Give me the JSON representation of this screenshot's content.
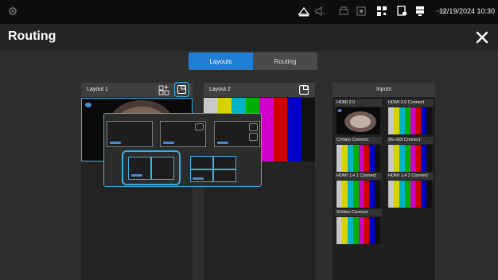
{
  "status": {
    "clock": "12/19/2024 10:30"
  },
  "header": {
    "title": "Routing"
  },
  "tabs": [
    {
      "label": "Layouts",
      "active": true
    },
    {
      "label": "Routing",
      "active": false
    }
  ],
  "layouts": [
    {
      "label": "Layout 1"
    },
    {
      "label": "Layout 2"
    }
  ],
  "inputs": {
    "title": "Inputs",
    "items": [
      {
        "label": "HDMI 2.0",
        "kind": "camera"
      },
      {
        "label": "HDMI 2.0 Connect",
        "kind": "bars"
      },
      {
        "label": "CVideo Connect",
        "kind": "bars"
      },
      {
        "label": "3G-SDI Connect",
        "kind": "bars"
      },
      {
        "label": "HDMI 1.4 1 Connect",
        "kind": "bars"
      },
      {
        "label": "HDMI 1.4 2 Connect",
        "kind": "bars"
      },
      {
        "label": "SVideo Connect",
        "kind": "bars"
      }
    ]
  },
  "colors": {
    "accent": "#1f7fd6",
    "highlight": "#3ab0e0",
    "bars": [
      "#c8c8c8",
      "#d6d200",
      "#00b4c8",
      "#00b000",
      "#d000c8",
      "#d00000",
      "#0000c8",
      "#111111"
    ]
  },
  "layout_picker": {
    "options": [
      "full-with-pip",
      "full-with-two-pips-right",
      "side-by-side",
      "quad-grid"
    ]
  }
}
